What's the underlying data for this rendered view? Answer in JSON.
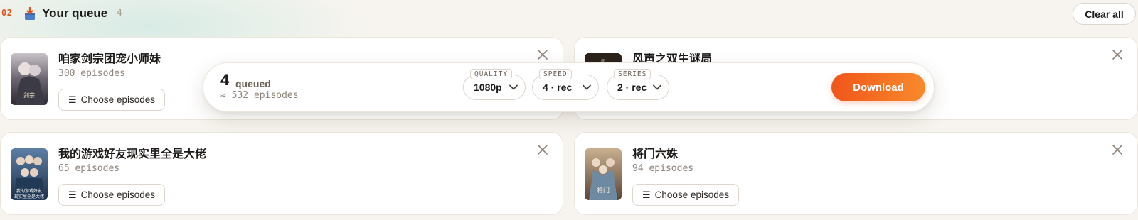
{
  "header": {
    "step": "02",
    "title": "Your queue",
    "count": "4",
    "clear_label": "Clear all",
    "icon": "download-box-icon"
  },
  "cards": [
    {
      "title": "咱家剑宗团宠小师妹",
      "episodes": "300 episodes",
      "choose_label": "Choose episodes",
      "poster_text": "咱家剑宗团宠小师妹",
      "poster_colors": [
        "#3b3a45",
        "#c9c3c8"
      ]
    },
    {
      "title": "风声之双生谜局",
      "episodes": "",
      "choose_label": "",
      "poster_text": "风",
      "poster_colors": [
        "#1a1512",
        "#3a2e26"
      ]
    },
    {
      "title": "我的游戏好友现实里全是大佬",
      "episodes": "65 episodes",
      "choose_label": "Choose episodes",
      "poster_text": "我的游戏好友 现实里全是大佬",
      "poster_colors": [
        "#1f3a5c",
        "#4f6f8f"
      ]
    },
    {
      "title": "将门六姝",
      "episodes": "94 episodes",
      "choose_label": "Choose episodes",
      "poster_text": "将门六姝",
      "poster_colors": [
        "#6b5442",
        "#b89c7d"
      ]
    }
  ],
  "download_bar": {
    "count": "4",
    "queued_label": "queued",
    "approx_episodes": "≈ 532 episodes",
    "quality": {
      "label": "QUALITY",
      "value": "1080p"
    },
    "speed": {
      "label": "SPEED",
      "value": "4 · rec"
    },
    "series": {
      "label": "SERIES",
      "value": "2 · rec"
    },
    "download_label": "Download"
  },
  "colors": {
    "accent": "#f0561a",
    "accent_end": "#f98a2c",
    "step": "#e0541c"
  }
}
